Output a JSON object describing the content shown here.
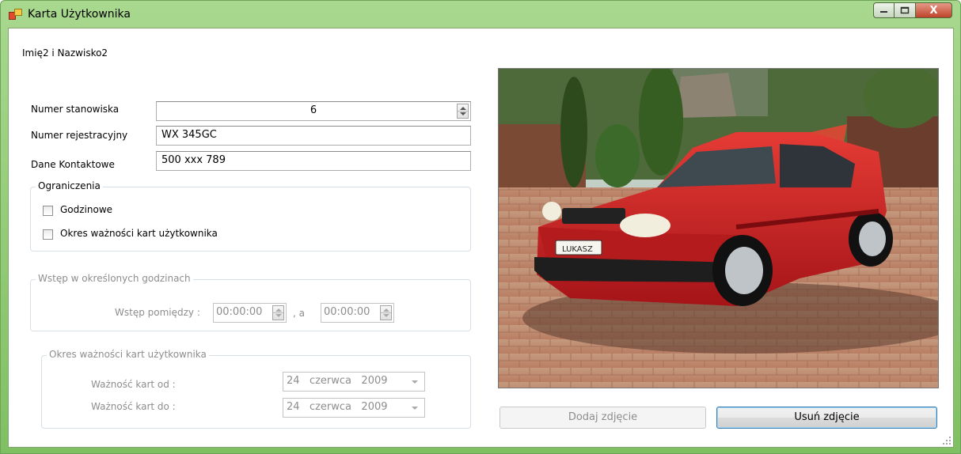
{
  "window": {
    "title": "Karta Użytkownika",
    "buttons": {
      "minimize": "minimize-icon",
      "maximize": "maximize-icon",
      "close": "X"
    }
  },
  "user": {
    "name": "Imię2 i Nazwisko2"
  },
  "form": {
    "station_label": "Numer stanowiska",
    "station_value": "6",
    "registration_label": "Numer rejestracyjny",
    "registration_value": "WX 345GC",
    "contact_label": "Dane Kontaktowe",
    "contact_value": "500 xxx 789"
  },
  "restrictions": {
    "legend": "Ograniczenia",
    "hourly_label": "Godzinowe",
    "hourly_checked": false,
    "validity_label": "Okres ważności kart użytkownika",
    "validity_checked": false
  },
  "hours_group": {
    "legend": "Wstęp w określonych godzinach",
    "between_label": "Wstęp pomiędzy :",
    "from_time": "00:00:00",
    "and_label": ", a",
    "to_time": "00:00:00"
  },
  "validity_group": {
    "legend": "Okres ważności kart użytkownika",
    "from_label": "Ważność kart od :",
    "from_day": "24",
    "from_month": "czerwca",
    "from_year": "2009",
    "to_label": "Ważność kart do :",
    "to_day": "24",
    "to_month": "czerwca",
    "to_year": "2009"
  },
  "photo": {
    "plate_text": "LUKASZ"
  },
  "buttons": {
    "add_photo": "Dodaj zdjęcie",
    "remove_photo": "Usuń zdjęcie"
  }
}
